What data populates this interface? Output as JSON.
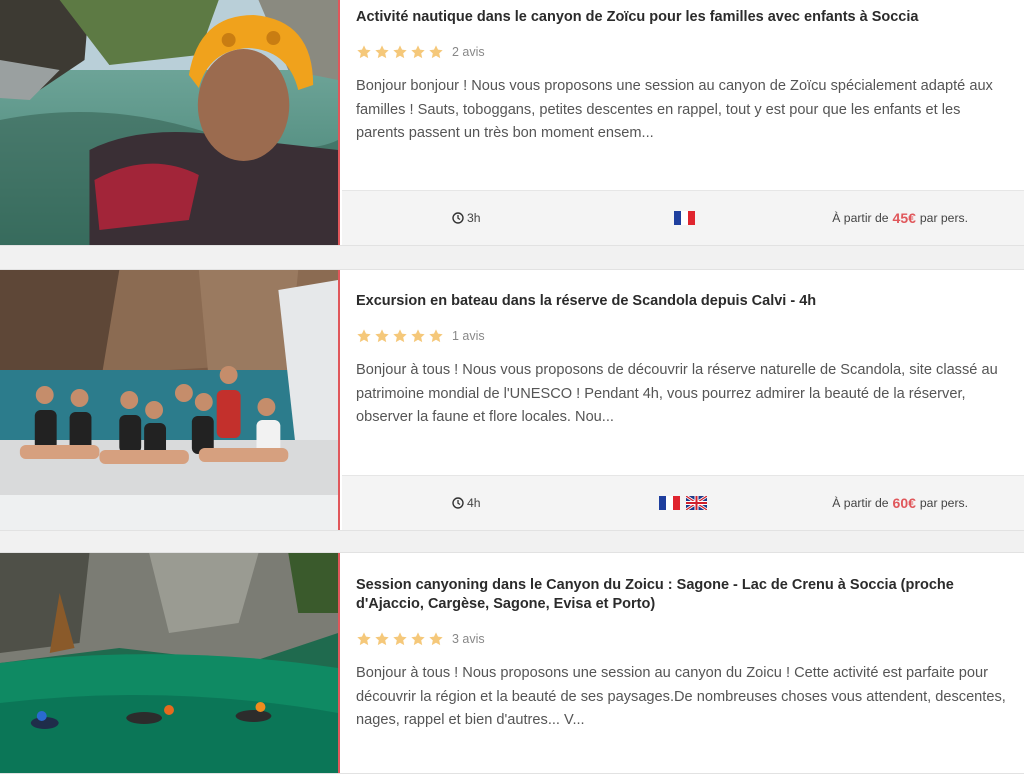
{
  "activities": [
    {
      "title": "Activité nautique dans le canyon de Zoïcu pour les familles avec enfants à Soccia",
      "reviews": "2 avis",
      "description": "Bonjour bonjour ! Nous vous proposons une session au canyon de Zoïcu spécialement adapté aux familles ! Sauts, toboggans, petites descentes en rappel, tout y est pour que les enfants et les parents passent un très bon moment ensem...",
      "duration": "3h",
      "price_prefix": "À partir de",
      "price": "45€",
      "price_suffix": "par pers.",
      "languages": [
        "french-flag"
      ],
      "image": "child-with-yellow-helmet-in-river"
    },
    {
      "title": "Excursion en bateau dans la réserve de Scandola depuis Calvi - 4h",
      "reviews": "1 avis",
      "description": "Bonjour à tous ! Nous vous proposons de découvrir la réserve naturelle de Scandola, site classé au patrimoine mondial de l'UNESCO ! Pendant 4h, vous pourrez admirer la beauté de la réserver, observer la faune et flore locales. Nou...",
      "duration": "4h",
      "price_prefix": "À partir de",
      "price": "60€",
      "price_suffix": "par pers.",
      "languages": [
        "french-flag",
        "uk-flag"
      ],
      "image": "group-of-women-on-boat"
    },
    {
      "title": "Session canyoning dans le Canyon du Zoicu : Sagone - Lac de Crenu à Soccia (proche d'Ajaccio, Cargèse, Sagone, Evisa et Porto)",
      "reviews": "3 avis",
      "description": "Bonjour à tous ! Nous proposons une session au canyon du Zoicu ! Cette activité est parfaite pour découvrir la région et la beauté de ses paysages.De nombreuses choses vous attendent, descentes, nages, rappel et bien d'autres... V...",
      "image": "swimmers-in-green-canyon-pool"
    }
  ],
  "colors": {
    "accent": "#e0575b",
    "star": "#f5c87a",
    "footer_bg": "#f4f4f4"
  },
  "rating_stars": 5
}
